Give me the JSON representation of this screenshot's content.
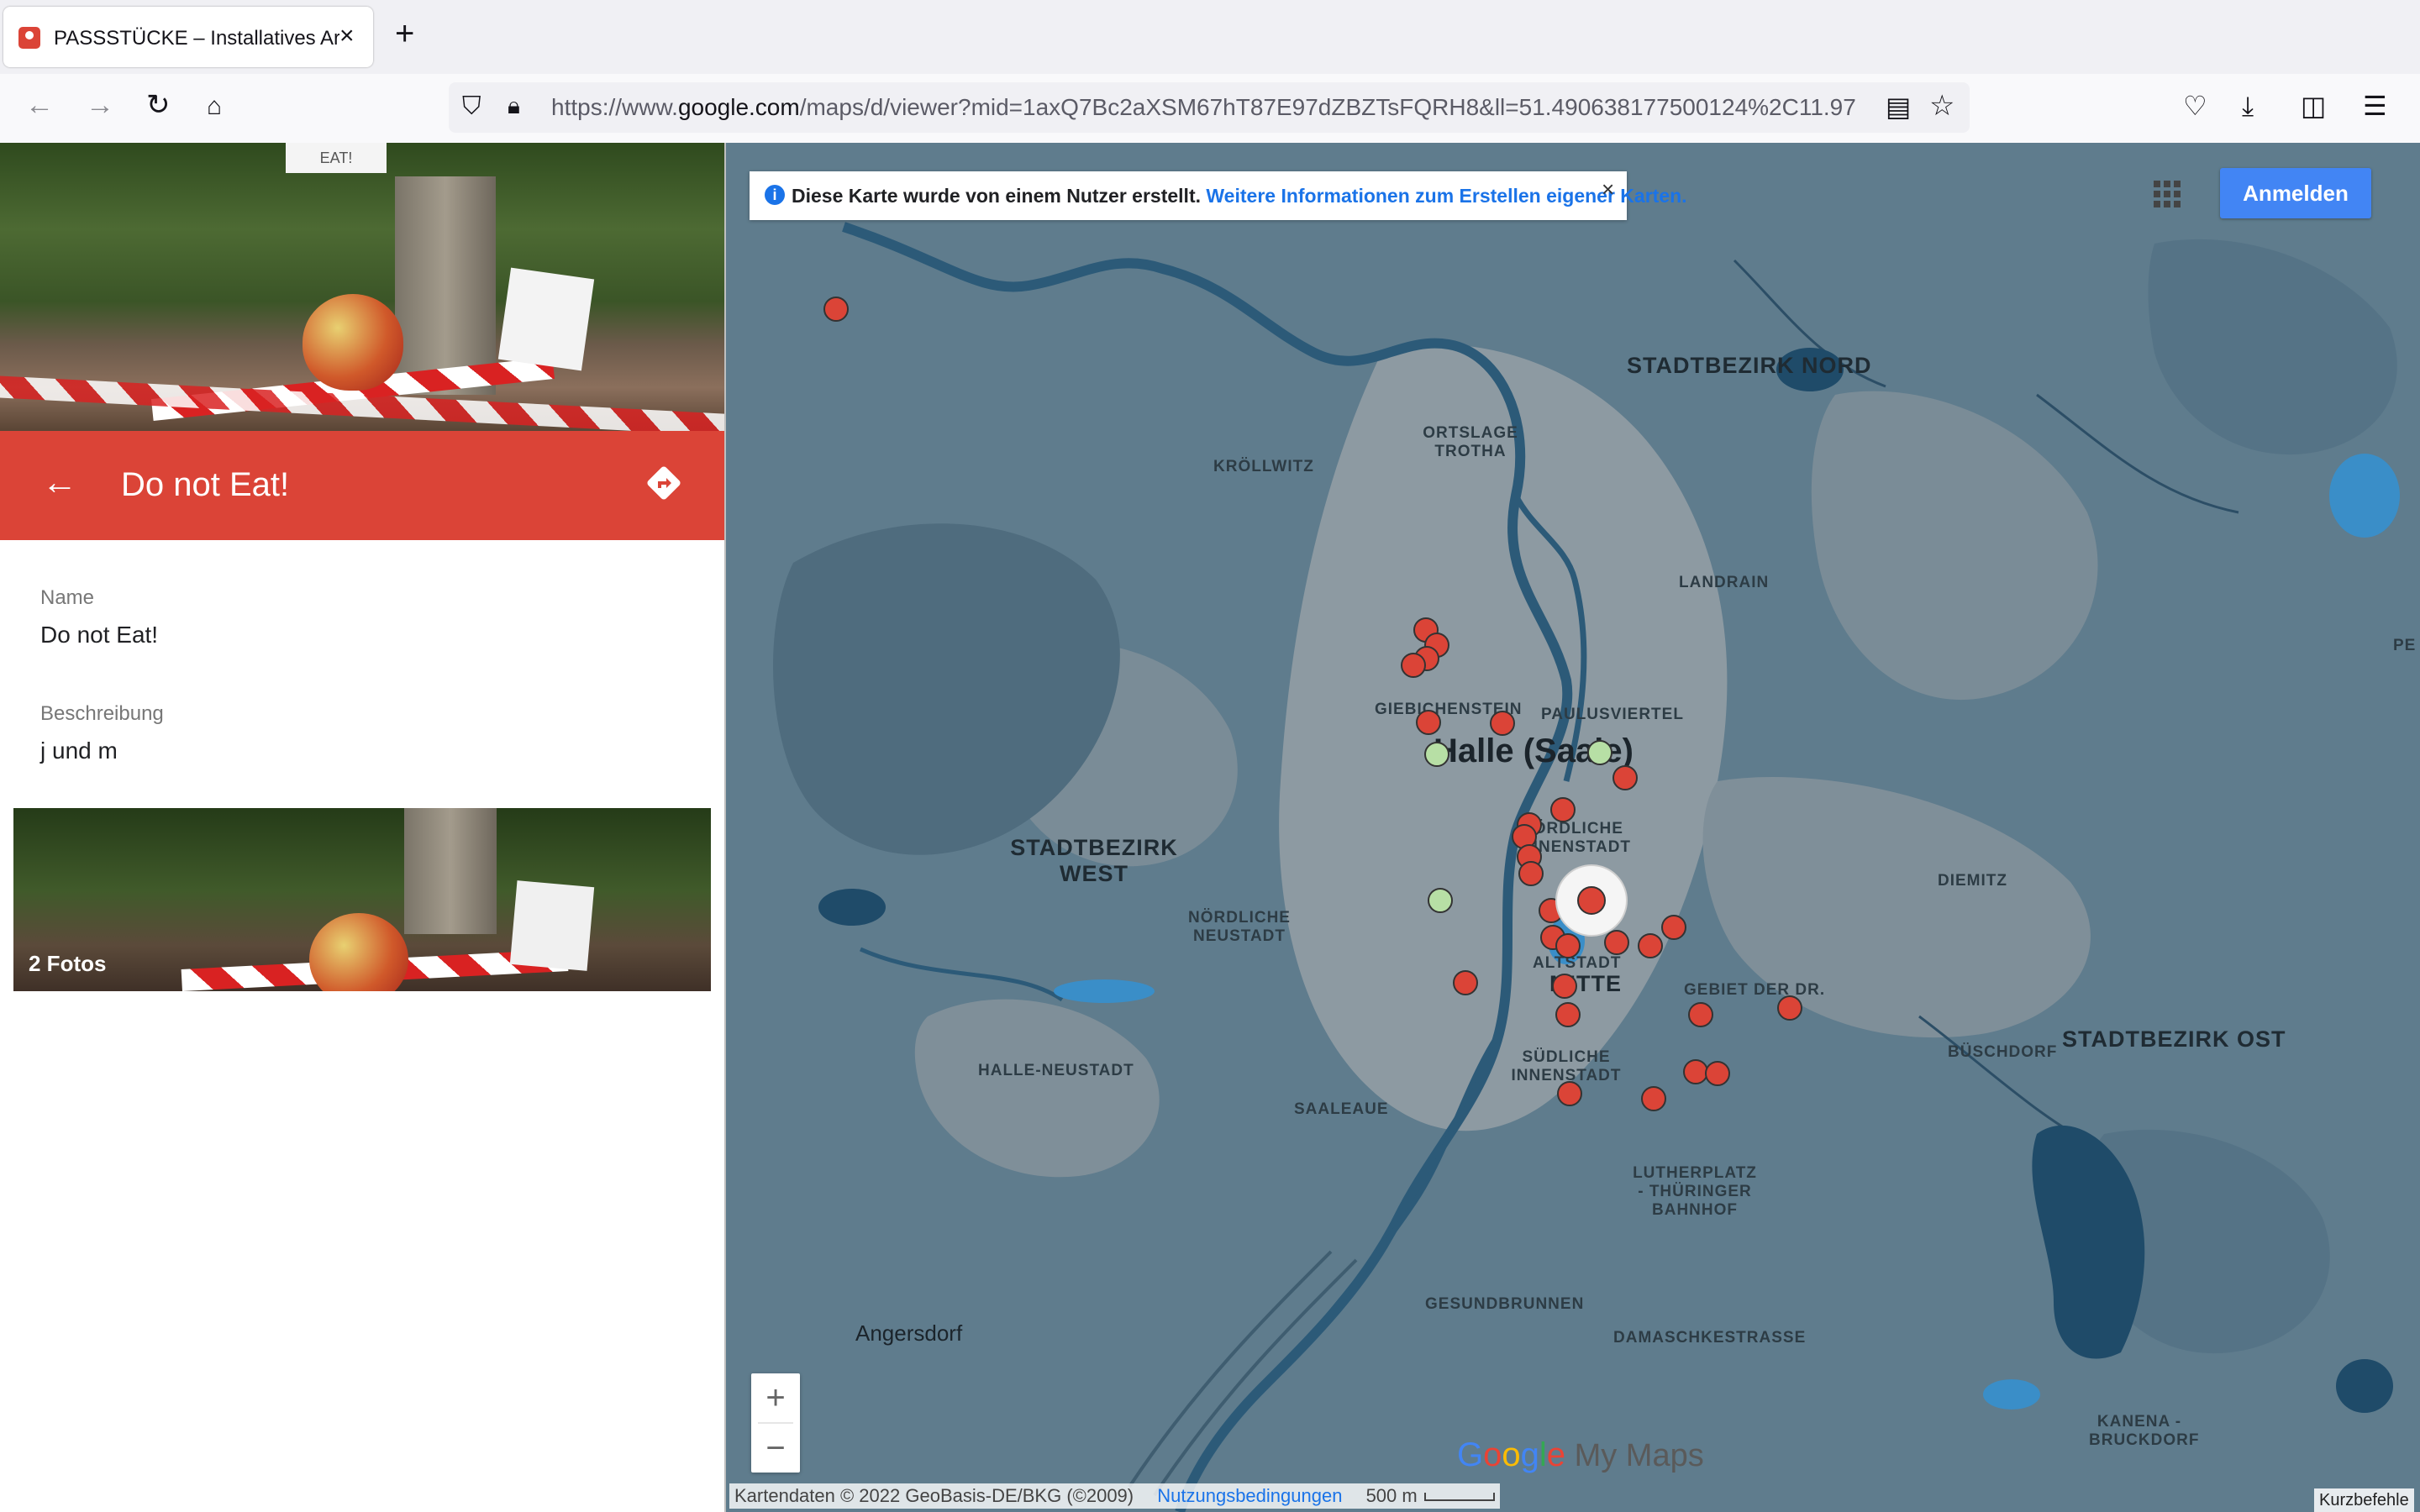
{
  "browser": {
    "tab_title": "PASSSTÜCKE – Installatives Arbeiten",
    "url_prefix": "https://www.",
    "url_domain": "google.com",
    "url_rest": "/maps/d/viewer?mid=1axQ7Bc2aXSM67hT87E97dZBZTsFQRH8&ll=51.490638177500124%2C11.97",
    "new_tab": "+",
    "tab_close": "×"
  },
  "hero_photo": {
    "sign_text": "EAT!"
  },
  "panel": {
    "title": "Do not Eat!",
    "fields": [
      {
        "label": "Name",
        "value": "Do not Eat!"
      },
      {
        "label": "Beschreibung",
        "value": "j und m"
      }
    ],
    "photos_label": "2 Fotos"
  },
  "map": {
    "info_text": "Diese Karte wurde von einem Nutzer erstellt.",
    "info_link": "Weitere Informationen zum Erstellen eigener Karten.",
    "signin_label": "Anmelden",
    "labels": {
      "stadtbezirk_nord": "STADTBEZIRK NORD",
      "ortslage_trotha": "ORTSLAGE TROTHA",
      "kroellwitz": "KRÖLLWITZ",
      "landrain": "LANDRAIN",
      "giebichenstein": "GIEBICHENSTEIN",
      "paulusviertel": "PAULUSVIERTEL",
      "city": "Halle (Saale)",
      "noerdliche_innenstadt": "NÖRDLICHE INNENSTADT",
      "stadtbezirk_west": "STADTBEZIRK WEST",
      "noerdliche_neustadt": "NÖRDLICHE NEUSTADT",
      "diemitz": "DIEMITZ",
      "altstadt": "ALTSTADT",
      "mitte": "MITTE",
      "gebiet_der_dr": "GEBIET DER DR.",
      "halle_neustadt": "HALLE-NEUSTADT",
      "saaleaue": "SAALEAUE",
      "suedliche_innenstadt": "SÜDLICHE INNENSTADT",
      "bueschdorf": "BÜSCHDORF",
      "stadtbezirk_ost": "STADTBEZIRK OST",
      "lutherplatz": "LUTHERPLATZ - THÜRINGER BAHNHOF",
      "gesundbrunnen": "GESUNDBRUNNEN",
      "damaschkestrasse": "DAMASCHKESTRASSE",
      "angersdorf": "Angersdorf",
      "kanena": "KANENA - BRUCKDORF",
      "east_edge": "PE"
    },
    "brand": {
      "g1": "G",
      "o1": "o",
      "o2": "o",
      "g2": "g",
      "l": "l",
      "e": "e",
      "mymaps": " My Maps"
    },
    "footer": {
      "data": "Kartendaten © 2022 GeoBasis-DE/BKG (©2009)",
      "terms": "Nutzungsbedingungen",
      "scale": "500 m"
    },
    "shortcuts": "Kurzbefehle",
    "marker_colors": {
      "red": "#db4437",
      "green": "#b7dfa5"
    }
  }
}
